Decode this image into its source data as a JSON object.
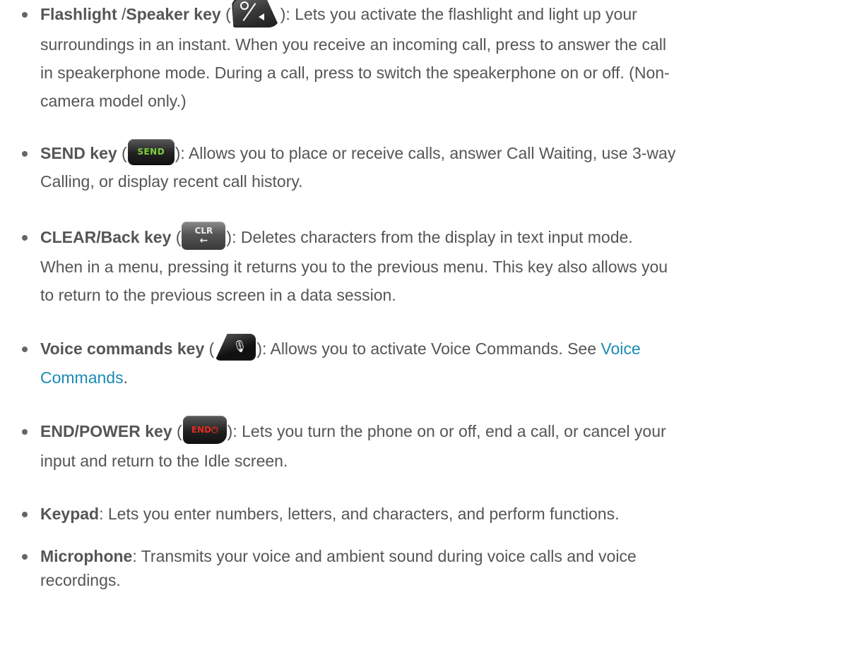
{
  "items": [
    {
      "term": "Flashlight",
      "term_sep": " /",
      "term2": "Speaker key",
      "icon_name": "flashlight-speaker-key-icon",
      "paren_open": " (",
      "paren_close": "): ",
      "line1": "Lets you activate the flashlight and light up your",
      "line2": "surroundings in an instant. When you receive an incoming call, press to answer the call",
      "line3": "in speakerphone mode. During a call, press to switch the speakerphone on or off. (Non-",
      "line4": "camera model only.)"
    },
    {
      "term": "SEND key",
      "icon_name": "send-key-icon",
      "icon_text": "SEND",
      "paren_open": " (",
      "paren_close": "): ",
      "line1": "Allows you to place or receive calls, answer Call Waiting, use 3-way",
      "line2": "Calling, or display recent call history."
    },
    {
      "term": "CLEAR/Back key",
      "icon_name": "clr-key-icon",
      "icon_text": "CLR",
      "icon_arrow": "←",
      "paren_open": " (",
      "paren_close": "): ",
      "line1": "Deletes characters from the display in text input mode.",
      "line2": "When in a menu, pressing it returns you to the previous menu. This key also allows you",
      "line3": "to return to the previous screen in a data session."
    },
    {
      "term": "Voice commands key",
      "icon_name": "voice-commands-key-icon",
      "icon_text": "🎙",
      "paren_open": " (",
      "paren_close": "): ",
      "line1": "Allows you to activate Voice Commands. See ",
      "link_part1": "Voice",
      "link_part2": "Commands",
      "line2_after": "."
    },
    {
      "term": "END/POWER key",
      "icon_name": "end-power-key-icon",
      "icon_text": "END⏻",
      "paren_open": " (",
      "paren_close": "): ",
      "line1": "Lets you turn the phone on or off, end a call, or cancel your",
      "line2": "input and return to the Idle screen."
    },
    {
      "term": "Keypad",
      "sep": ": ",
      "line1": "Lets you enter numbers, letters, and characters, and perform functions."
    },
    {
      "term": "Microphone",
      "sep": ": ",
      "line1": "Transmits your voice and ambient sound during voice calls and voice",
      "line2": "recordings."
    }
  ],
  "colors": {
    "text": "#555555",
    "link": "#1a8bb5",
    "send_green": "#7ccf3a",
    "end_red": "#e02a1f"
  }
}
